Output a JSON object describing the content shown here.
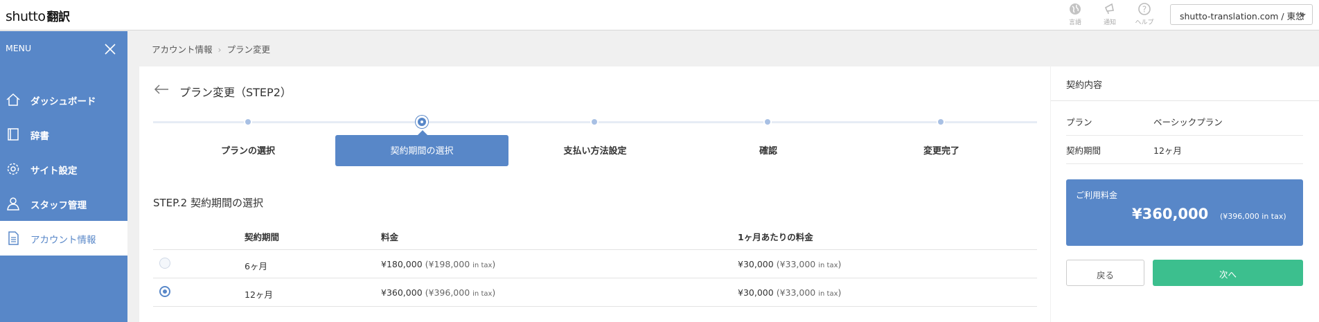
{
  "header": {
    "logo_en": "shutto",
    "logo_jp": "翻訳",
    "icons": [
      {
        "name": "language-icon",
        "label": "言語"
      },
      {
        "name": "notification-icon",
        "label": "通知"
      },
      {
        "name": "help-icon",
        "label": "ヘルプ"
      }
    ],
    "site_select": "shutto-translation.com / 東悠"
  },
  "sidebar": {
    "menu_label": "MENU",
    "items": [
      {
        "label": "ダッシュボード",
        "icon": "home-icon",
        "active": false
      },
      {
        "label": "辞書",
        "icon": "book-icon",
        "active": false
      },
      {
        "label": "サイト設定",
        "icon": "gear-icon",
        "active": false
      },
      {
        "label": "スタッフ管理",
        "icon": "staff-icon",
        "active": false
      },
      {
        "label": "アカウント情報",
        "icon": "document-icon",
        "active": true
      }
    ]
  },
  "breadcrumb": [
    "アカウント情報",
    "プラン変更"
  ],
  "main": {
    "title": "プラン変更（STEP2）",
    "steps": [
      {
        "label": "プランの選択"
      },
      {
        "label": "契約期間の選択"
      },
      {
        "label": "支払い方法設定"
      },
      {
        "label": "確認"
      },
      {
        "label": "変更完了"
      }
    ],
    "current_step": 2,
    "section_title": "STEP.2 契約期間の選択",
    "table": {
      "headers": [
        "契約期間",
        "料金",
        "1ヶ月あたりの料金"
      ],
      "rows": [
        {
          "selected": false,
          "period": "6ヶ月",
          "price": "¥180,000",
          "price_tax": "(¥198,000",
          "monthly": "¥30,000",
          "monthly_tax": "(¥33,000"
        },
        {
          "selected": true,
          "period": "12ヶ月",
          "price": "¥360,000",
          "price_tax": "(¥396,000",
          "monthly": "¥30,000",
          "monthly_tax": "(¥33,000"
        }
      ],
      "in_tax": "in tax",
      "close_paren": ")"
    }
  },
  "summary": {
    "title": "契約内容",
    "plan_key": "プラン",
    "plan_value": "ベーシックプラン",
    "period_key": "契約期間",
    "period_value": "12ヶ月",
    "fee_label": "ご利用料金",
    "fee_amount": "¥360,000",
    "fee_tax": "(¥396,000 in tax)",
    "back_label": "戻る",
    "next_label": "次へ"
  },
  "colors": {
    "brand_blue": "#5887c8",
    "next_green": "#3cbf8e"
  }
}
